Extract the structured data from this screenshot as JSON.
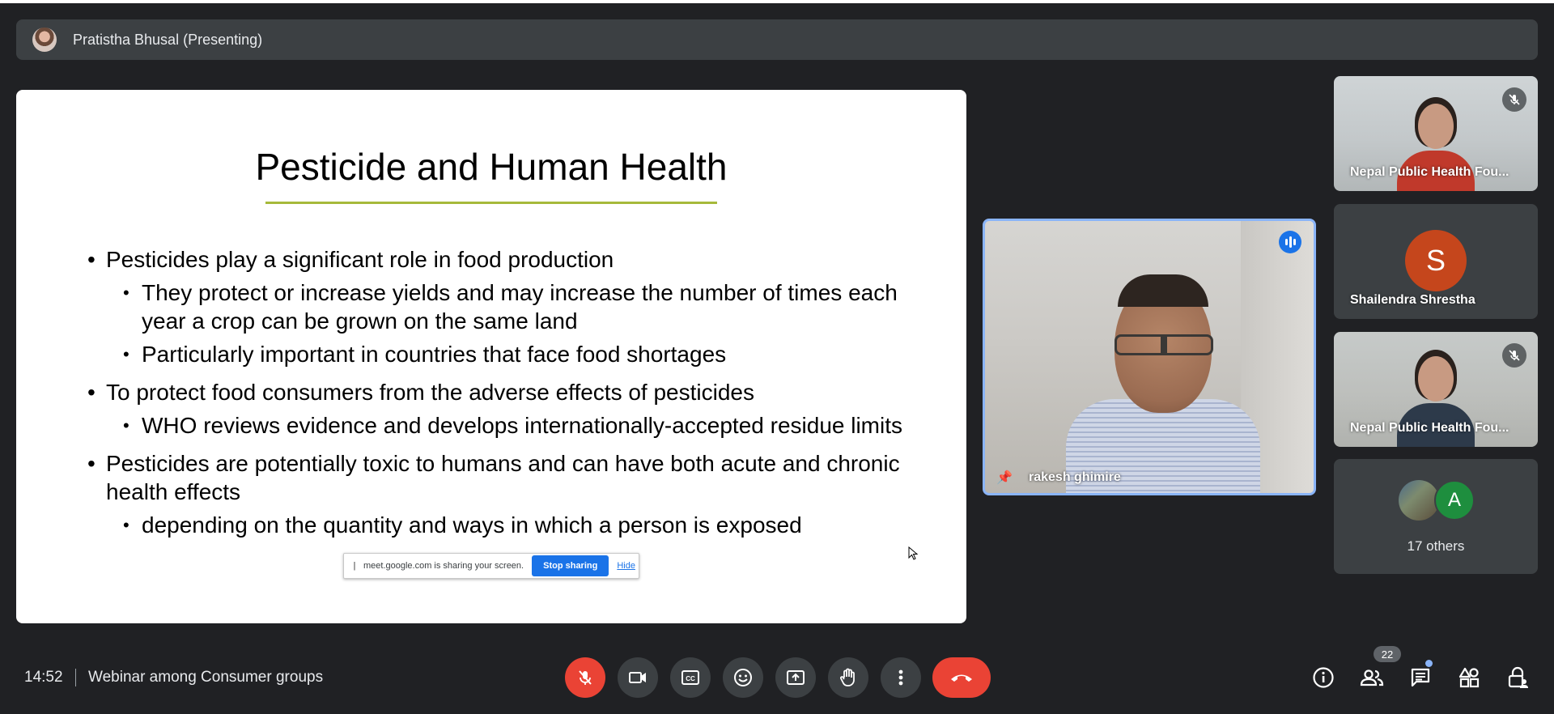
{
  "presenter": {
    "name": "Pratistha Bhusal (Presenting)"
  },
  "slide": {
    "title": "Pesticide and Human Health",
    "b1": "Pesticides play a significant role in food production",
    "b1_1": "They protect or increase yields and may increase the number of times each year a crop can be grown on the same land",
    "b1_2": "Particularly important in countries that face food shortages",
    "b2": "To protect food consumers from the adverse effects of pesticides",
    "b2_1": "WHO reviews evidence and develops internationally-accepted residue limits",
    "b3": "Pesticides are potentially toxic to humans and can have both acute and chronic health effects",
    "b3_1": "depending on the quantity and ways in which a person is exposed"
  },
  "share_notice": {
    "text": "meet.google.com is sharing your screen.",
    "stop_label": "Stop sharing",
    "hide_label": "Hide"
  },
  "speaker": {
    "name": "rakesh ghimire"
  },
  "participants": {
    "tile1_name": "Nepal Public Health Fou...",
    "tile2_initial": "S",
    "tile2_name": "Shailendra Shrestha",
    "tile3_name": "Nepal Public Health Fou...",
    "others_initial": "A",
    "others_label": "17 others"
  },
  "bottom": {
    "time": "14:52",
    "meeting_title": "Webinar among Consumer groups",
    "people_count": "22"
  },
  "colors": {
    "background": "#202124",
    "tile": "#3c4043",
    "end_call": "#ea4335",
    "accent": "#1a73e8",
    "speaking_border": "#8ab4f8",
    "title_underline": "#a6b93a"
  }
}
